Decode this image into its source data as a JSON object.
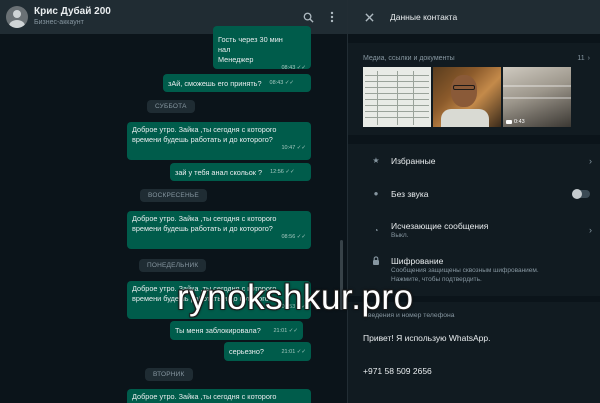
{
  "chat": {
    "title": "Крис Дубай 200",
    "subtitle": "Бизнес-аккаунт",
    "header_icons": [
      "search-icon",
      "menu-icon"
    ],
    "messages": [
      {
        "text": "Гость через 30 мин\nнал\nМенеджер",
        "time": "08:43"
      },
      {
        "text": "зАй, сможешь его принять?",
        "time": "08:43"
      },
      {
        "text": "Доброе утро. Зайка ,ты сегодня с которого\nвремени будешь работать и до которого?",
        "time": "10:47"
      },
      {
        "text": "зай у тебя анал скольок ?",
        "time": "12:56"
      },
      {
        "text": "Доброе утро. Зайка ,ты сегодня с которого\nвремени будешь работать и до которого?",
        "time": "08:56"
      },
      {
        "text": "Доброе утро. Зайка ,ты сегодня с которого\nвремени будешь работать и до которого?",
        "time": "08:53"
      },
      {
        "text": "Ты меня заблокировала?",
        "time": "21:01"
      },
      {
        "text": "серьезно?",
        "time": "21:01"
      },
      {
        "text": "Доброе утро. Зайка ,ты сегодня с которого",
        "time": ""
      }
    ],
    "days": [
      "СУББОТА",
      "ВОСКРЕСЕНЬЕ",
      "ПОНЕДЕЛЬНИК",
      "ВТОРНИК"
    ]
  },
  "panel": {
    "title": "Данные контакта",
    "media_label": "Медиа, ссылки и документы",
    "media_count": "11",
    "video_duration": "0:43",
    "favorites": "Избранные",
    "mute": "Без звука",
    "mute_enabled": false,
    "disappearing": "Исчезающие сообщения",
    "disappearing_sub": "Выкл.",
    "encryption": "Шифрование",
    "encryption_sub1": "Сообщения защищены сквозным шифрованием.",
    "encryption_sub2": "Нажмите, чтобы подтвердить.",
    "about_title": "Сведения и номер телефона",
    "about_text": "Привет! Я использую WhatsApp.",
    "phone": "+971 58 509 2656"
  },
  "watermark": "rynokshkur.pro",
  "colors": {
    "bubble_out": "#005c4b",
    "chat_bg": "#0b141a",
    "panel_bg": "#111b21",
    "header_bg": "#202c33"
  }
}
